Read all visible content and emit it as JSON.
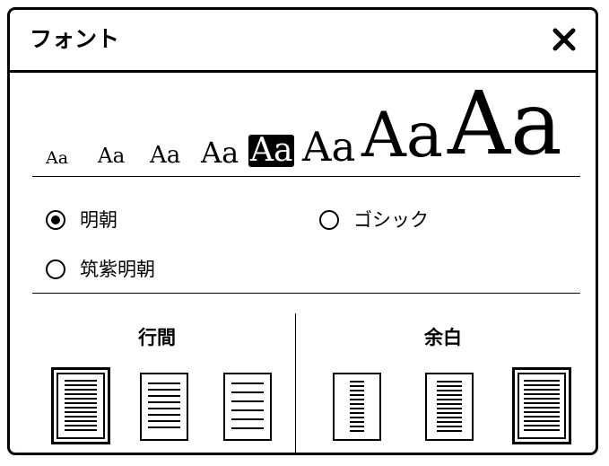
{
  "dialog": {
    "title": "フォント",
    "close_icon": "close-icon"
  },
  "font_sizes": {
    "options": [
      "Aa",
      "Aa",
      "Aa",
      "Aa",
      "Aa",
      "Aa",
      "Aa",
      "Aa"
    ],
    "selected_index": 4
  },
  "typeface": {
    "options": [
      {
        "label": "明朝",
        "selected": true
      },
      {
        "label": "ゴシック",
        "selected": false
      },
      {
        "label": "筑紫明朝",
        "selected": false
      }
    ]
  },
  "line_spacing": {
    "title": "行間",
    "selected_index": 0
  },
  "margins": {
    "title": "余白",
    "selected_index": 2
  }
}
